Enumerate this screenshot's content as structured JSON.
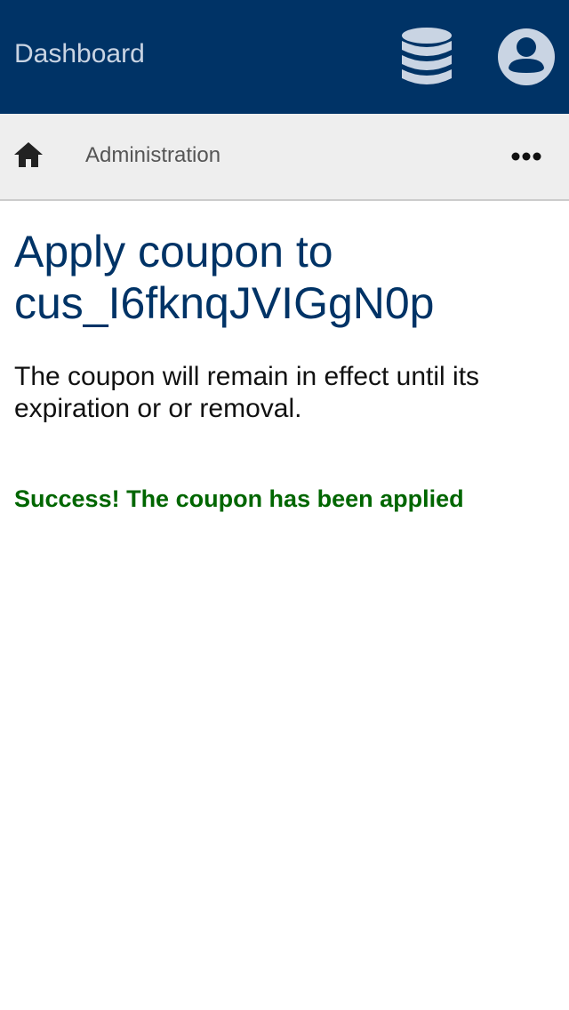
{
  "header": {
    "title": "Dashboard",
    "db_icon": "database-icon",
    "account_icon": "account-circle-icon",
    "background_color": "#003366"
  },
  "subnav": {
    "home_icon": "home-icon",
    "admin_label": "Administration",
    "more_icon": "more-horizontal-icon"
  },
  "main": {
    "title": "Apply coupon to cus_I6fknqJVIGgN0p",
    "description": "The coupon will remain in effect until its expiration or or removal.",
    "success_message": "Success! The coupon has been applied",
    "success_color": "#006600"
  }
}
